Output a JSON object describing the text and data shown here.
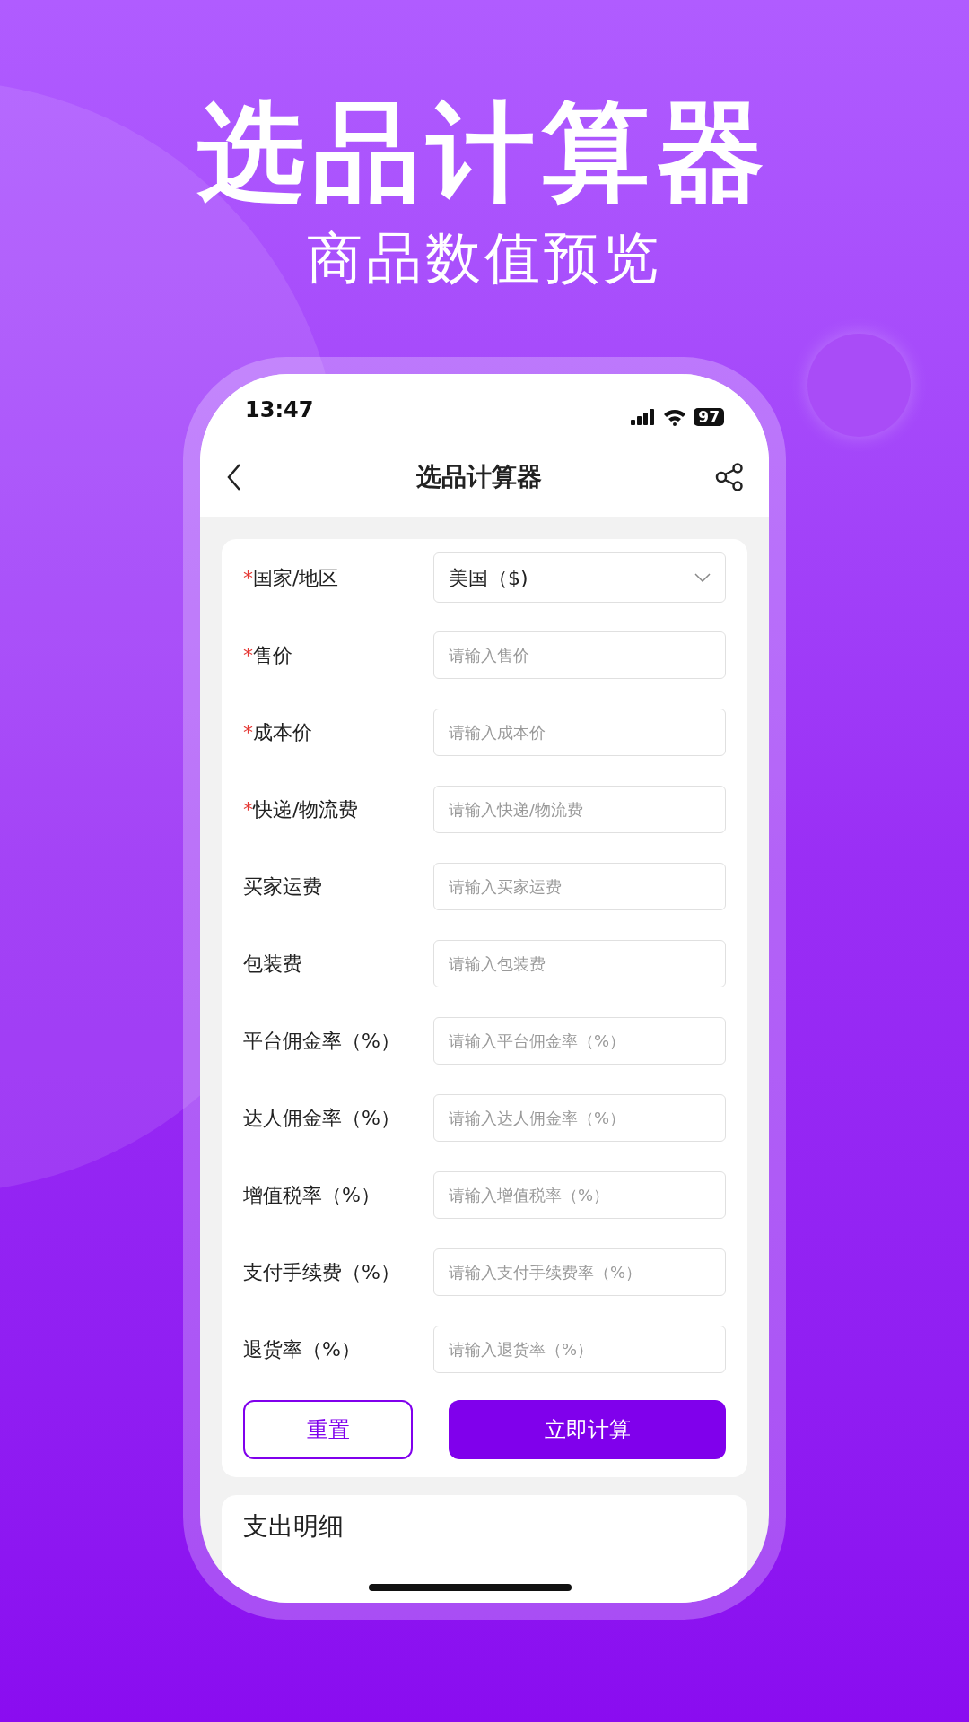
{
  "headline": {
    "title": "选品计算器",
    "subtitle": "商品数值预览"
  },
  "status_bar": {
    "time": "13:47",
    "battery": "97"
  },
  "nav_bar": {
    "title": "选品计算器"
  },
  "form": {
    "fields": [
      {
        "kind": "select",
        "label": "国家/地区",
        "required": true,
        "value": "美国（$)"
      },
      {
        "kind": "input",
        "label": "售价",
        "required": true,
        "placeholder": "请输入售价"
      },
      {
        "kind": "input",
        "label": "成本价",
        "required": true,
        "placeholder": "请输入成本价"
      },
      {
        "kind": "input",
        "label": "快递/物流费",
        "required": true,
        "placeholder": "请输入快递/物流费"
      },
      {
        "kind": "input",
        "label": "买家运费",
        "required": false,
        "placeholder": "请输入买家运费"
      },
      {
        "kind": "input",
        "label": "包装费",
        "required": false,
        "placeholder": "请输入包装费"
      },
      {
        "kind": "input",
        "label": "平台佣金率（%）",
        "required": false,
        "placeholder": "请输入平台佣金率（%）"
      },
      {
        "kind": "input",
        "label": "达人佣金率（%）",
        "required": false,
        "placeholder": "请输入达人佣金率（%）"
      },
      {
        "kind": "input",
        "label": "增值税率（%）",
        "required": false,
        "placeholder": "请输入增值税率（%）"
      },
      {
        "kind": "input",
        "label": "支付手续费（%）",
        "required": false,
        "placeholder": "请输入支付手续费率（%）"
      },
      {
        "kind": "input",
        "label": "退货率（%）",
        "required": false,
        "placeholder": "请输入退货率（%）"
      }
    ],
    "required_mark": "*",
    "buttons": [
      {
        "kind": "outline",
        "label": "重置"
      },
      {
        "kind": "primary",
        "label": "立即计算"
      }
    ]
  },
  "expense_section": {
    "title": "支出明细"
  }
}
